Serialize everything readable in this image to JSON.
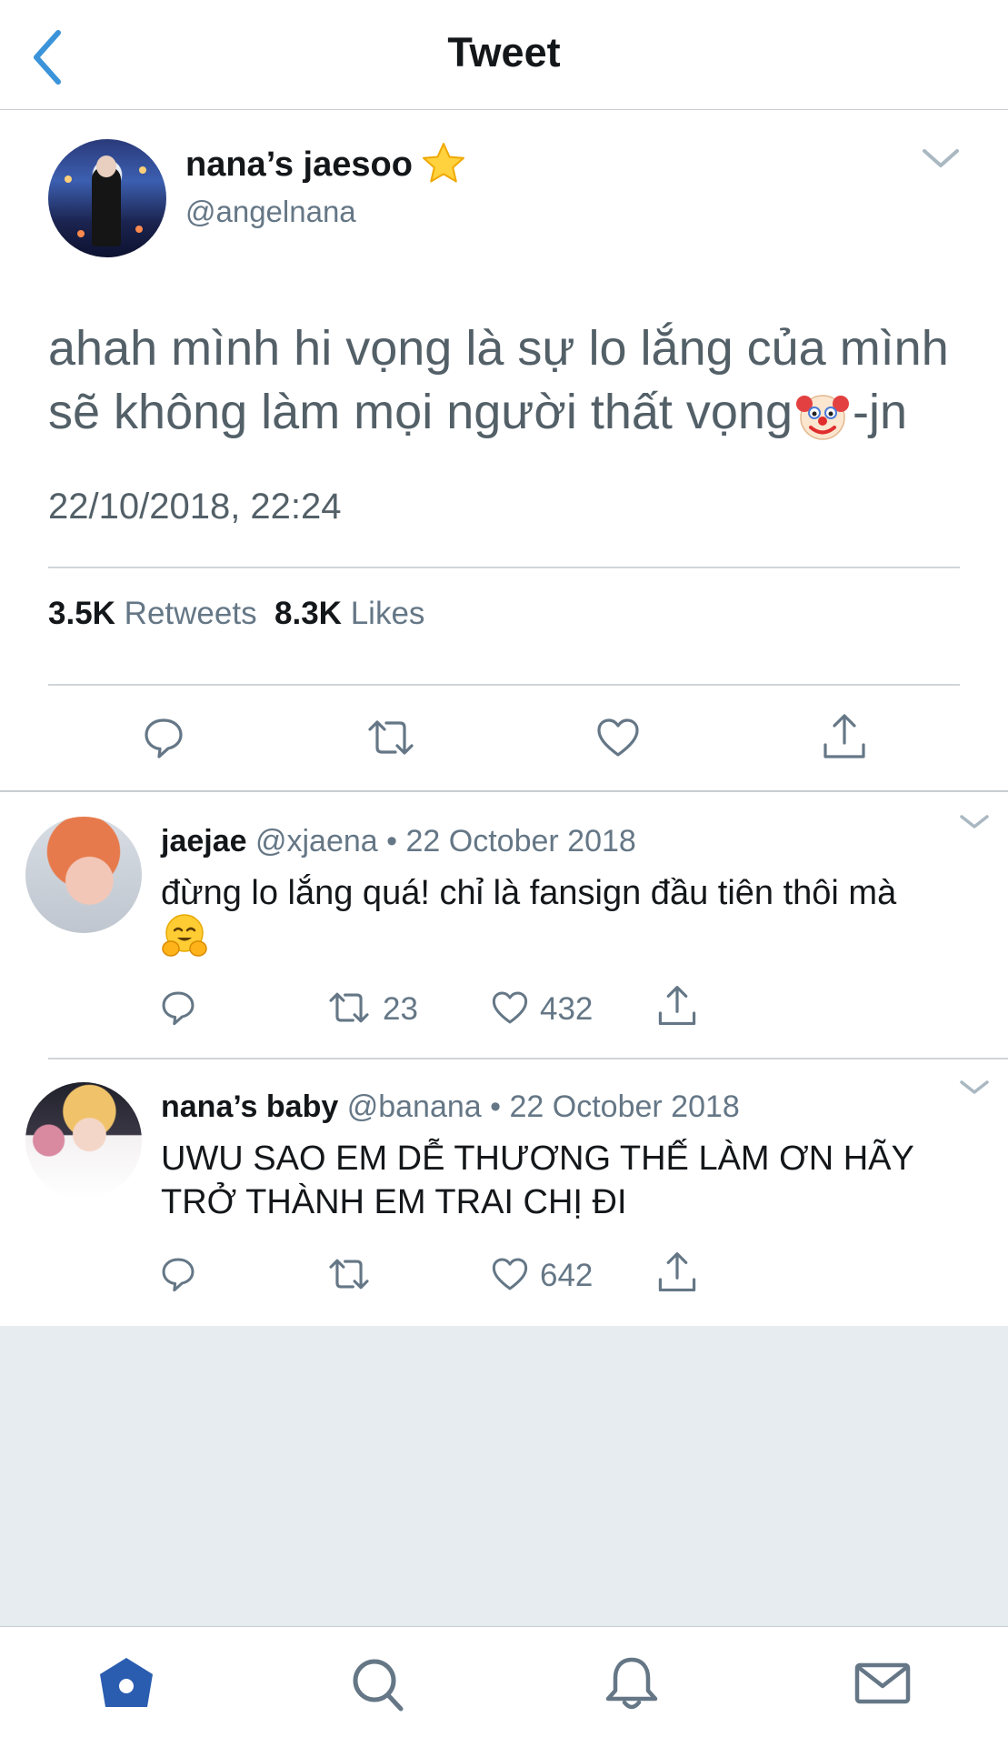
{
  "header": {
    "title": "Tweet",
    "back_icon": "chevron-left-icon"
  },
  "colors": {
    "accent": "#3b94d9",
    "text": "#14171a",
    "muted": "#657786",
    "empty_bg": "#e6ecf0",
    "home_active": "#2a5db0"
  },
  "main_tweet": {
    "display_name": "nana’s jaesoo",
    "name_emoji": "star-emoji",
    "handle": "@angelnana",
    "text_line1": "ahah mình hi vọng là sự lo lắng của mình",
    "text_line2a": "sẽ không làm mọi người thất vọng",
    "text_emoji": "clown-face-emoji",
    "text_line2b": "-jn",
    "timestamp": "22/10/2018, 22:24",
    "retweet_count": "3.5K",
    "retweet_label": "Retweets",
    "like_count": "8.3K",
    "like_label": "Likes",
    "actions": [
      "reply-icon",
      "retweet-icon",
      "like-icon",
      "share-icon"
    ]
  },
  "replies": [
    {
      "display_name": "jaejae",
      "handle": "@xjaena",
      "separator": "•",
      "date": "22 October 2018",
      "text": "đừng lo lắng quá! chỉ là fansign đầu tiên thôi mà",
      "emoji": "hugging-face-emoji",
      "retweets": "23",
      "likes": "432"
    },
    {
      "display_name": "nana’s baby",
      "handle": "@banana",
      "separator": "•",
      "date": "22 October 2018",
      "text_line1": "UWU SAO EM DỄ THƯƠNG THẾ LÀM ƠN HÃY",
      "text_line2": "TRỞ THÀNH EM TRAI CHỊ ĐI",
      "likes": "642"
    }
  ],
  "tabbar": {
    "tabs": [
      {
        "name": "home",
        "icon": "home-icon",
        "active": true
      },
      {
        "name": "search",
        "icon": "search-icon",
        "active": false
      },
      {
        "name": "notifications",
        "icon": "bell-icon",
        "active": false
      },
      {
        "name": "messages",
        "icon": "mail-icon",
        "active": false
      }
    ]
  }
}
